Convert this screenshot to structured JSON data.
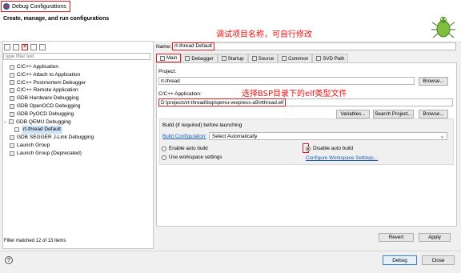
{
  "window": {
    "title": "Debug Configurations",
    "heading": "Create, manage, and run configurations"
  },
  "annotations": {
    "name_note": "调试项目名称，可自行修改",
    "app_note": "选择BSP目录下的elf类型文件"
  },
  "left": {
    "filter_placeholder": "type filter text",
    "tree": [
      {
        "label": "C/C++ Application",
        "indent": 1
      },
      {
        "label": "C/C++ Attach to Application",
        "indent": 1
      },
      {
        "label": "C/C++ Postmortem Debugger",
        "indent": 1
      },
      {
        "label": "C/C++ Remote Application",
        "indent": 1
      },
      {
        "label": "GDB Hardware Debugging",
        "indent": 1
      },
      {
        "label": "GDB OpenOCD Debugging",
        "indent": 1
      },
      {
        "label": "GDB PyOCD Debugging",
        "indent": 1
      },
      {
        "label": "GDB QEMU Debugging",
        "indent": 0,
        "expanded": true
      },
      {
        "label": "rt-thread Default",
        "indent": 2,
        "selected": true
      },
      {
        "label": "GDB SEGGER J-Link Debugging",
        "indent": 1
      },
      {
        "label": "Launch Group",
        "indent": 1
      },
      {
        "label": "Launch Group (Deprecated)",
        "indent": 1
      }
    ],
    "filter_status": "Filter matched 12 of 13 items"
  },
  "right": {
    "name_label": "Name:",
    "name_value": "rt-thread Default",
    "tabs": [
      {
        "label": "Main",
        "active": true
      },
      {
        "label": "Debugger"
      },
      {
        "label": "Startup"
      },
      {
        "label": "Source"
      },
      {
        "label": "Common"
      },
      {
        "label": "SVD Path"
      }
    ],
    "project_label": "Project:",
    "project_value": "rt-thread",
    "browse": "Browse...",
    "app_label": "C/C++ Application:",
    "app_value": "D:\\projects\\rt-thread\\bsp\\qemu-vexpress-a9\\rtthread.elf",
    "variables": "Variables...",
    "search_project": "Search Project...",
    "build_heading": "Build (if required) before launching",
    "build_config_label": "Build Configuration:",
    "build_config_value": "Select Automatically",
    "enable_auto_build": "Enable auto build",
    "disable_auto_build": "Disable auto build",
    "use_workspace": "Use workspace settings",
    "configure_workspace": "Configure Workspace Settings...",
    "revert": "Revert",
    "apply": "Apply"
  },
  "footer": {
    "help": "?",
    "debug": "Debug",
    "close": "Close"
  }
}
